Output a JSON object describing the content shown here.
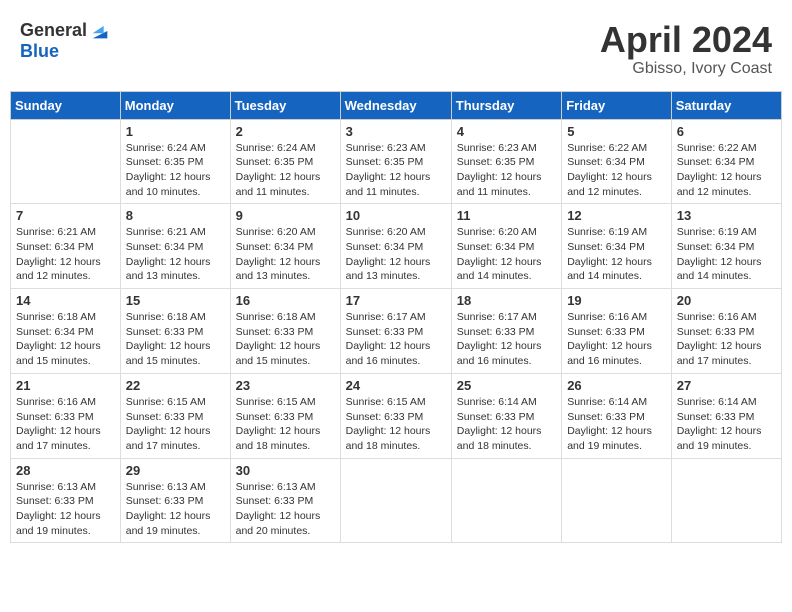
{
  "header": {
    "logo_general": "General",
    "logo_blue": "Blue",
    "month_year": "April 2024",
    "location": "Gbisso, Ivory Coast"
  },
  "days_of_week": [
    "Sunday",
    "Monday",
    "Tuesday",
    "Wednesday",
    "Thursday",
    "Friday",
    "Saturday"
  ],
  "weeks": [
    [
      {
        "day": "",
        "info": ""
      },
      {
        "day": "1",
        "info": "Sunrise: 6:24 AM\nSunset: 6:35 PM\nDaylight: 12 hours\nand 10 minutes."
      },
      {
        "day": "2",
        "info": "Sunrise: 6:24 AM\nSunset: 6:35 PM\nDaylight: 12 hours\nand 11 minutes."
      },
      {
        "day": "3",
        "info": "Sunrise: 6:23 AM\nSunset: 6:35 PM\nDaylight: 12 hours\nand 11 minutes."
      },
      {
        "day": "4",
        "info": "Sunrise: 6:23 AM\nSunset: 6:35 PM\nDaylight: 12 hours\nand 11 minutes."
      },
      {
        "day": "5",
        "info": "Sunrise: 6:22 AM\nSunset: 6:34 PM\nDaylight: 12 hours\nand 12 minutes."
      },
      {
        "day": "6",
        "info": "Sunrise: 6:22 AM\nSunset: 6:34 PM\nDaylight: 12 hours\nand 12 minutes."
      }
    ],
    [
      {
        "day": "7",
        "info": "Sunrise: 6:21 AM\nSunset: 6:34 PM\nDaylight: 12 hours\nand 12 minutes."
      },
      {
        "day": "8",
        "info": "Sunrise: 6:21 AM\nSunset: 6:34 PM\nDaylight: 12 hours\nand 13 minutes."
      },
      {
        "day": "9",
        "info": "Sunrise: 6:20 AM\nSunset: 6:34 PM\nDaylight: 12 hours\nand 13 minutes."
      },
      {
        "day": "10",
        "info": "Sunrise: 6:20 AM\nSunset: 6:34 PM\nDaylight: 12 hours\nand 13 minutes."
      },
      {
        "day": "11",
        "info": "Sunrise: 6:20 AM\nSunset: 6:34 PM\nDaylight: 12 hours\nand 14 minutes."
      },
      {
        "day": "12",
        "info": "Sunrise: 6:19 AM\nSunset: 6:34 PM\nDaylight: 12 hours\nand 14 minutes."
      },
      {
        "day": "13",
        "info": "Sunrise: 6:19 AM\nSunset: 6:34 PM\nDaylight: 12 hours\nand 14 minutes."
      }
    ],
    [
      {
        "day": "14",
        "info": "Sunrise: 6:18 AM\nSunset: 6:34 PM\nDaylight: 12 hours\nand 15 minutes."
      },
      {
        "day": "15",
        "info": "Sunrise: 6:18 AM\nSunset: 6:33 PM\nDaylight: 12 hours\nand 15 minutes."
      },
      {
        "day": "16",
        "info": "Sunrise: 6:18 AM\nSunset: 6:33 PM\nDaylight: 12 hours\nand 15 minutes."
      },
      {
        "day": "17",
        "info": "Sunrise: 6:17 AM\nSunset: 6:33 PM\nDaylight: 12 hours\nand 16 minutes."
      },
      {
        "day": "18",
        "info": "Sunrise: 6:17 AM\nSunset: 6:33 PM\nDaylight: 12 hours\nand 16 minutes."
      },
      {
        "day": "19",
        "info": "Sunrise: 6:16 AM\nSunset: 6:33 PM\nDaylight: 12 hours\nand 16 minutes."
      },
      {
        "day": "20",
        "info": "Sunrise: 6:16 AM\nSunset: 6:33 PM\nDaylight: 12 hours\nand 17 minutes."
      }
    ],
    [
      {
        "day": "21",
        "info": "Sunrise: 6:16 AM\nSunset: 6:33 PM\nDaylight: 12 hours\nand 17 minutes."
      },
      {
        "day": "22",
        "info": "Sunrise: 6:15 AM\nSunset: 6:33 PM\nDaylight: 12 hours\nand 17 minutes."
      },
      {
        "day": "23",
        "info": "Sunrise: 6:15 AM\nSunset: 6:33 PM\nDaylight: 12 hours\nand 18 minutes."
      },
      {
        "day": "24",
        "info": "Sunrise: 6:15 AM\nSunset: 6:33 PM\nDaylight: 12 hours\nand 18 minutes."
      },
      {
        "day": "25",
        "info": "Sunrise: 6:14 AM\nSunset: 6:33 PM\nDaylight: 12 hours\nand 18 minutes."
      },
      {
        "day": "26",
        "info": "Sunrise: 6:14 AM\nSunset: 6:33 PM\nDaylight: 12 hours\nand 19 minutes."
      },
      {
        "day": "27",
        "info": "Sunrise: 6:14 AM\nSunset: 6:33 PM\nDaylight: 12 hours\nand 19 minutes."
      }
    ],
    [
      {
        "day": "28",
        "info": "Sunrise: 6:13 AM\nSunset: 6:33 PM\nDaylight: 12 hours\nand 19 minutes."
      },
      {
        "day": "29",
        "info": "Sunrise: 6:13 AM\nSunset: 6:33 PM\nDaylight: 12 hours\nand 19 minutes."
      },
      {
        "day": "30",
        "info": "Sunrise: 6:13 AM\nSunset: 6:33 PM\nDaylight: 12 hours\nand 20 minutes."
      },
      {
        "day": "",
        "info": ""
      },
      {
        "day": "",
        "info": ""
      },
      {
        "day": "",
        "info": ""
      },
      {
        "day": "",
        "info": ""
      }
    ]
  ]
}
